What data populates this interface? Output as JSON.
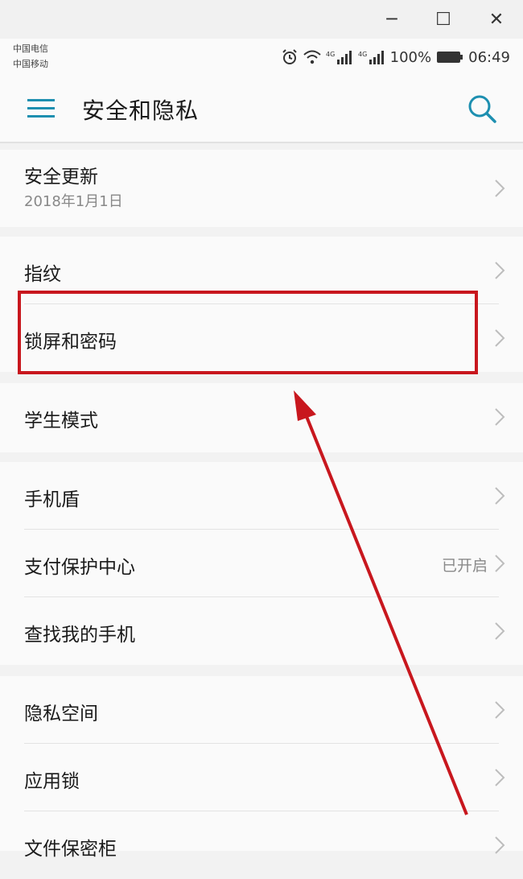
{
  "window": {
    "minimize": "─",
    "maximize": "☐",
    "close": "✕"
  },
  "status": {
    "carrier1": "中国电信",
    "carrier2": "中国移动",
    "battery": "100%",
    "time": "06:49"
  },
  "header": {
    "title": "安全和隐私"
  },
  "groups": [
    {
      "rows": [
        {
          "label": "安全更新",
          "sub": "2018年1月1日"
        }
      ]
    },
    {
      "rows": [
        {
          "label": "指纹"
        },
        {
          "label": "锁屏和密码"
        }
      ]
    },
    {
      "rows": [
        {
          "label": "学生模式"
        }
      ]
    },
    {
      "rows": [
        {
          "label": "手机盾"
        },
        {
          "label": "支付保护中心",
          "value": "已开启"
        },
        {
          "label": "查找我的手机"
        }
      ]
    },
    {
      "rows": [
        {
          "label": "隐私空间"
        },
        {
          "label": "应用锁"
        },
        {
          "label": "文件保密柜"
        }
      ]
    }
  ],
  "annotation": {
    "color": "#c8171e"
  }
}
